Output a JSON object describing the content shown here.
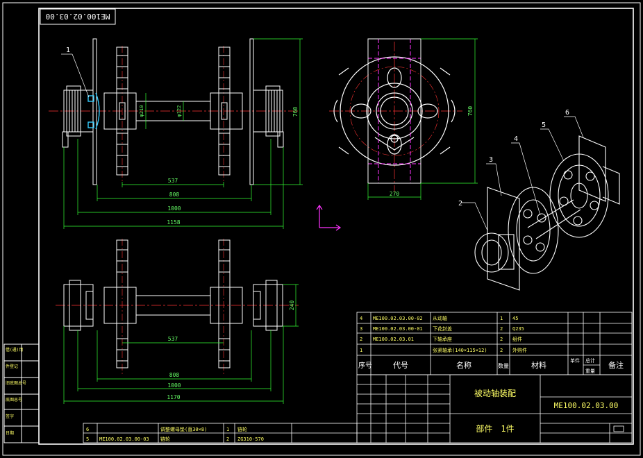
{
  "drawing_number_rotated": "ME100.02.03.00",
  "drawing_number": "ME100.02.03.00",
  "assembly_title": "被动轴装配",
  "part_info": "部件　1件",
  "balloons": [
    "1",
    "2",
    "3",
    "4",
    "5",
    "6"
  ],
  "dims_front": {
    "d_210": "φ210",
    "d_122": "φ122",
    "h_760": "760",
    "w_537": "537",
    "w_808": "808",
    "w_1000": "1000",
    "w_1158": "1158"
  },
  "dims_side": {
    "h_760": "760",
    "w_270": "270"
  },
  "dims_bottom": {
    "h_240": "240",
    "w_537": "537",
    "w_808": "808",
    "w_1000": "1000",
    "w_1170": "1170"
  },
  "bom_headers": {
    "seq": "序号",
    "code": "代号",
    "name": "名称",
    "qty": "数量",
    "material": "材料",
    "single": "单件",
    "total": "总计",
    "weight": "重量",
    "remark": "备注"
  },
  "bom_rows": [
    {
      "seq": "4",
      "code": "ME100.02.03.00-02",
      "name": "从动轴",
      "qty": "1",
      "material": "45"
    },
    {
      "seq": "3",
      "code": "ME100.02.03.00-01",
      "name": "下花封盖",
      "qty": "2",
      "material": "Q235"
    },
    {
      "seq": "2",
      "code": "ME100.02.03.01",
      "name": "下轴承座",
      "qty": "2",
      "material": "组件"
    },
    {
      "seq": "1",
      "code": "",
      "name": "张紧轴承(140×115×12)",
      "qty": "2",
      "material": "外购件"
    }
  ],
  "bom_rows_lower": [
    {
      "seq": "6",
      "code": "",
      "name": "调整螺母垫(直30×8)",
      "qty": "1",
      "material": "链轮"
    },
    {
      "seq": "5",
      "code": "ME100.02.03.00-03",
      "name": "链轮",
      "qty": "2",
      "material": "ZG310-570"
    }
  ],
  "left_strip_labels": [
    "借(通)用",
    "件登记",
    "旧底图总号",
    "底图总号",
    "签字",
    "日期"
  ],
  "colors": {
    "outline": "#ffffff",
    "dimension": "#33ff33",
    "centerline": "#ff3333",
    "hidden": "#ff33ff",
    "highlight": "#33ccff",
    "table_text": "#ffff66",
    "ucs": "#ff33ff"
  }
}
